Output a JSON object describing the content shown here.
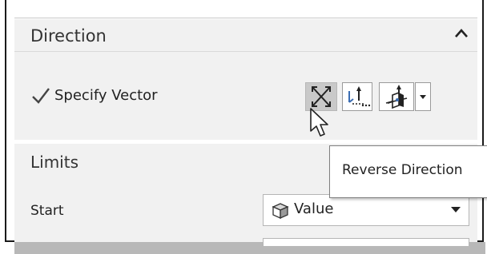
{
  "direction_group": {
    "title": "Direction",
    "vector_label": "Specify Vector",
    "tools": [
      "reverse-direction",
      "csys-origin",
      "vector-type",
      "vector-type-dropdown"
    ]
  },
  "limits_group": {
    "title": "Limits",
    "start_label": "Start",
    "start_value": "Value"
  },
  "tooltip": {
    "text": "Reverse Direction"
  },
  "colors": {
    "panel_bg": "#f1f1f1",
    "hover_button": "#c9c9c9",
    "frame": "#1a1a1a"
  }
}
